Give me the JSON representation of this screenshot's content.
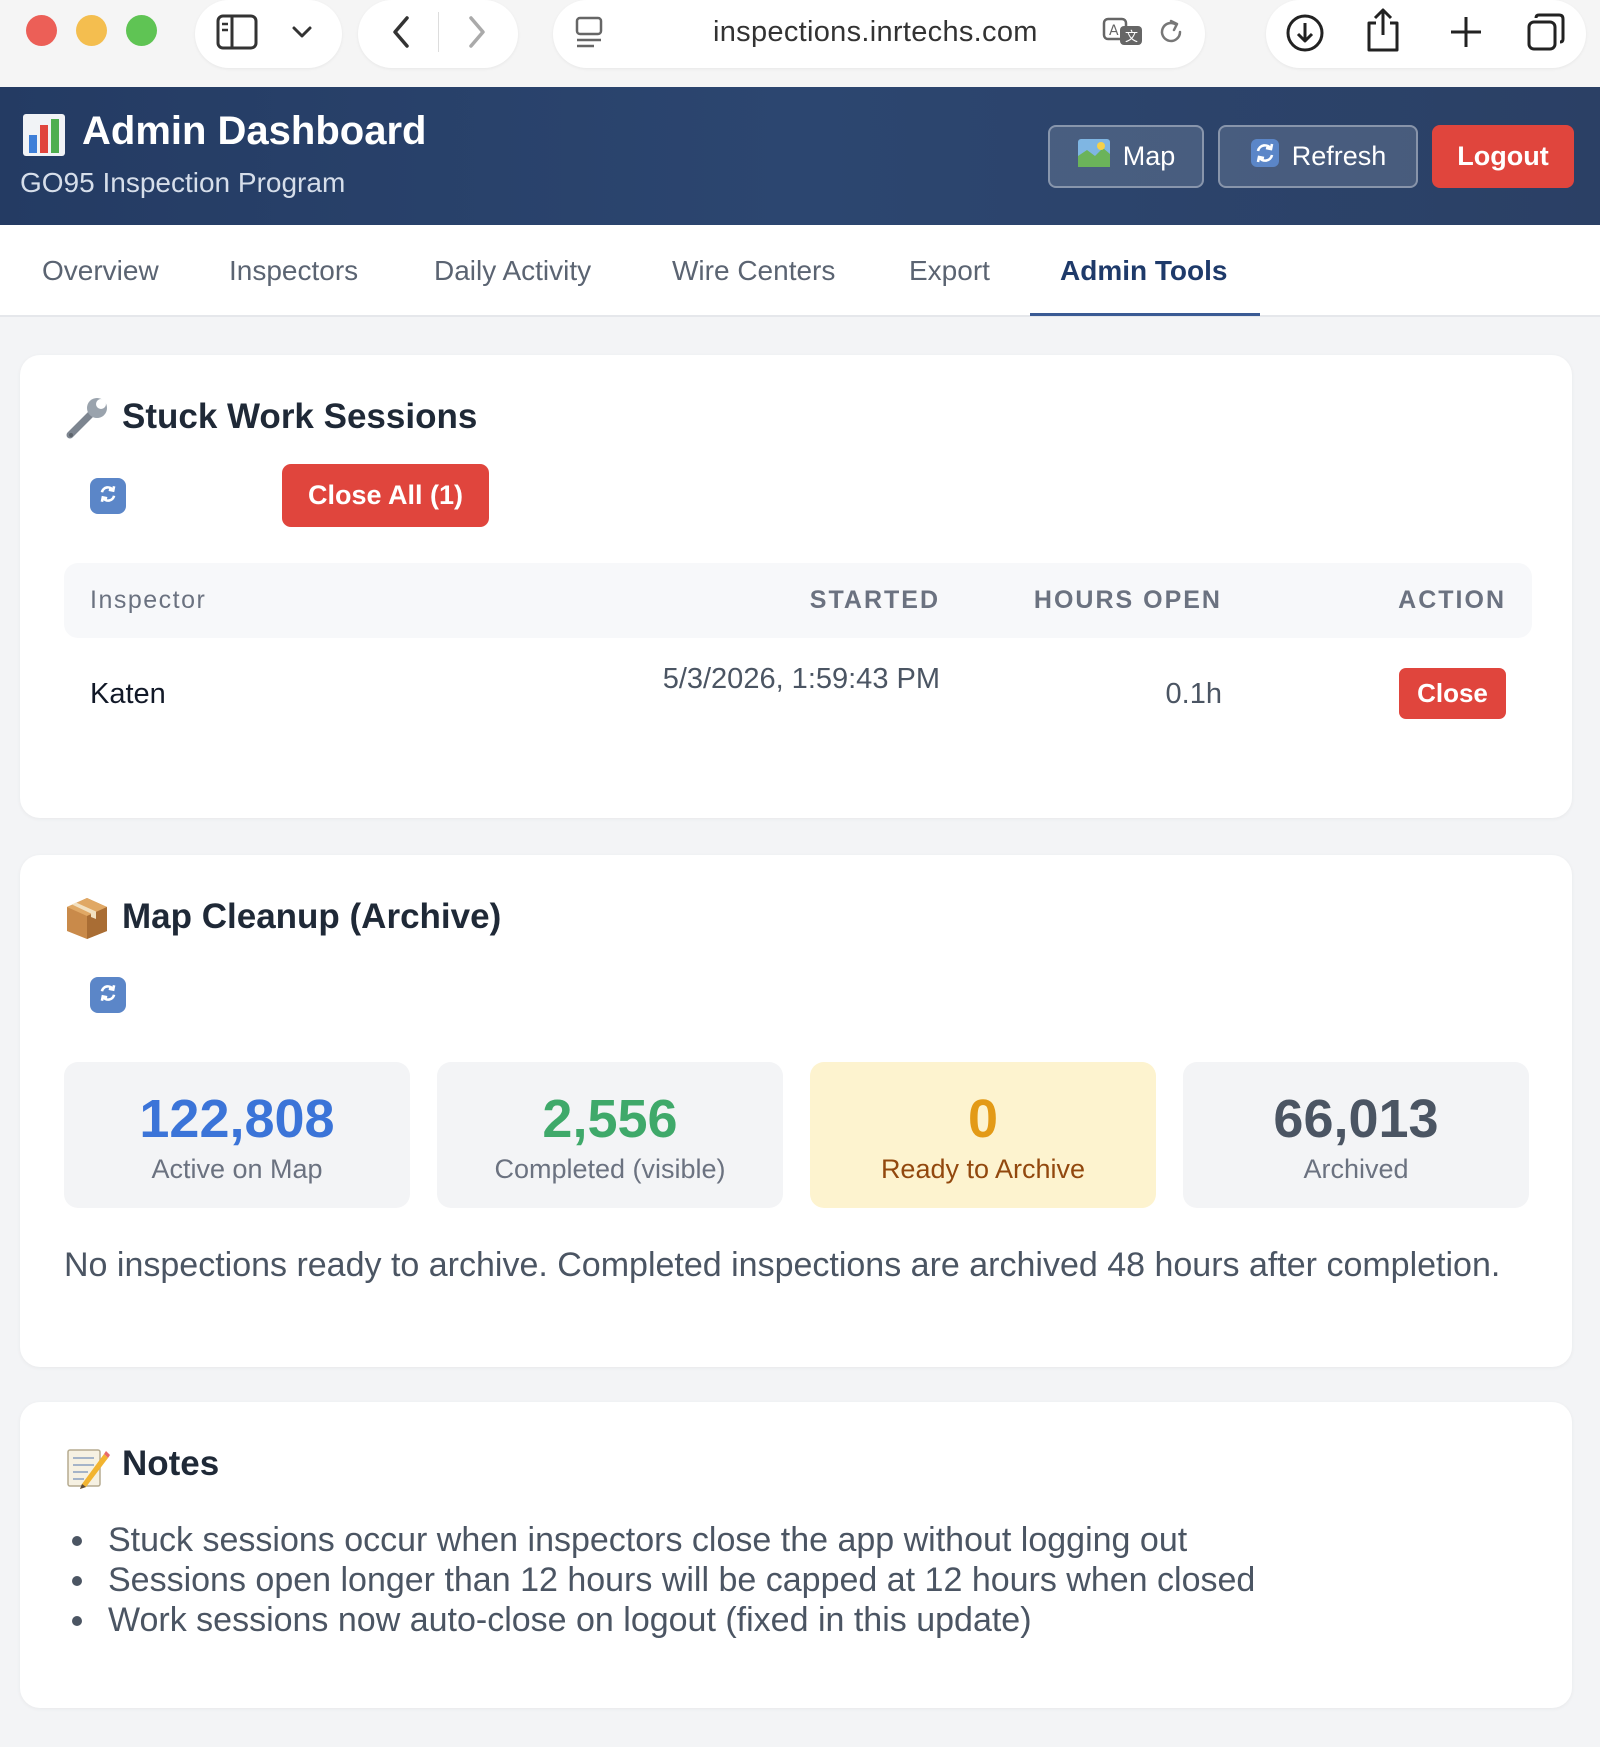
{
  "browser": {
    "url": "inspections.inrtechs.com"
  },
  "header": {
    "title": "Admin Dashboard",
    "subtitle": "GO95 Inspection Program",
    "map_label": "Map",
    "refresh_label": "Refresh",
    "logout_label": "Logout"
  },
  "tabs": [
    {
      "label": "Overview"
    },
    {
      "label": "Inspectors"
    },
    {
      "label": "Daily Activity"
    },
    {
      "label": "Wire Centers"
    },
    {
      "label": "Export"
    },
    {
      "label": "Admin Tools",
      "active": true
    }
  ],
  "stuck_sessions": {
    "title": "Stuck Work Sessions",
    "close_all_label": "Close All (1)",
    "columns": {
      "inspector": "Inspector",
      "started": "STARTED",
      "hours_open": "HOURS OPEN",
      "action": "ACTION"
    },
    "rows": [
      {
        "inspector": "Katen",
        "started": "5/3/2026, 1:59:43 PM",
        "hours_open": "0.1h",
        "action_label": "Close"
      }
    ]
  },
  "map_cleanup": {
    "title": "Map Cleanup (Archive)",
    "stats": [
      {
        "value": "122,808",
        "label": "Active on Map",
        "color": "#3b74d8"
      },
      {
        "value": "2,556",
        "label": "Completed (visible)",
        "color": "#3fa96a"
      },
      {
        "value": "0",
        "label": "Ready to Archive",
        "color": "#e39a17"
      },
      {
        "value": "66,013",
        "label": "Archived",
        "color": "#4b5563"
      }
    ],
    "note": "No inspections ready to archive. Completed inspections are archived 48 hours after completion."
  },
  "notes": {
    "title": "Notes",
    "items": [
      "Stuck sessions occur when inspectors close the app without logging out",
      "Sessions open longer than 12 hours will be capped at 12 hours when closed",
      "Work sessions now auto-close on logout (fixed in this update)"
    ]
  },
  "colors": {
    "header_bg": "#2a4269",
    "danger": "#e0453d",
    "active_tab": "#1e3a6a"
  }
}
